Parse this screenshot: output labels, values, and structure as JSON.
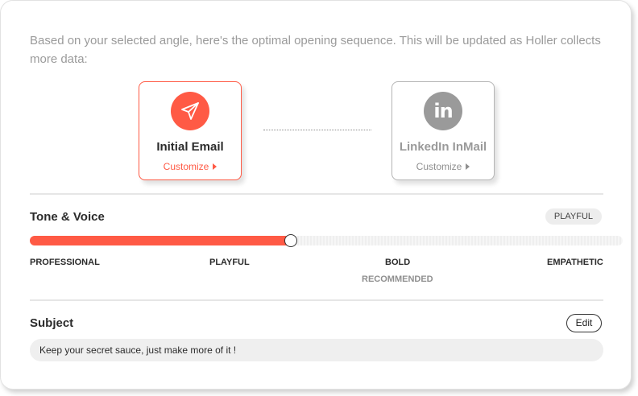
{
  "intro_text": "Based on your selected angle, here's the optimal opening sequence. This will be updated as Holler collects more data:",
  "sequence": {
    "steps": [
      {
        "title": "Initial Email",
        "customize_label": "Customize",
        "icon": "paper-plane-icon",
        "active": true
      },
      {
        "title": "LinkedIn InMail",
        "customize_label": "Customize",
        "icon": "linkedin-icon",
        "icon_text": "in",
        "active": false
      }
    ]
  },
  "tone": {
    "title": "Tone & Voice",
    "selected": "PLAYFUL",
    "slider_value": 0.44,
    "scale_labels": [
      "PROFESSIONAL",
      "PLAYFUL",
      "BOLD",
      "EMPATHETIC"
    ],
    "recommended_label": "RECOMMENDED"
  },
  "subject": {
    "title": "Subject",
    "edit_label": "Edit",
    "value": "Keep your secret sauce, just make more of it !"
  },
  "colors": {
    "accent": "#ff5a45",
    "inactive": "#9a9a9a"
  }
}
